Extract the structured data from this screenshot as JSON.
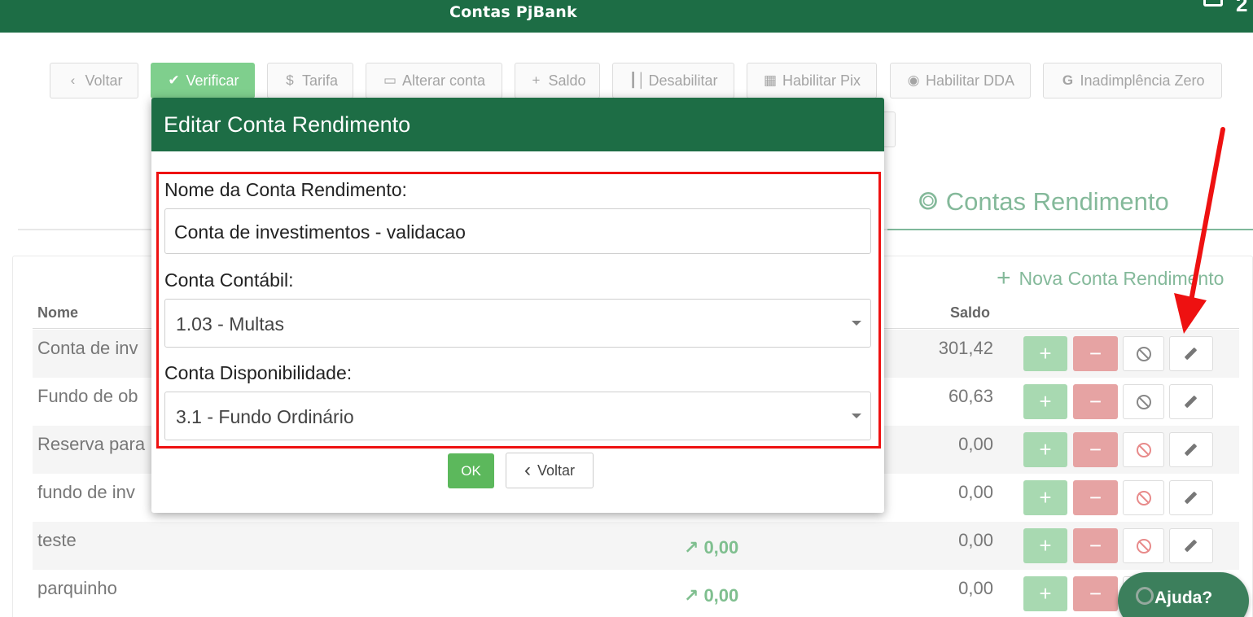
{
  "header": {
    "title": "Contas PjBank",
    "corner_text": "2"
  },
  "toolbar": {
    "voltar": "Voltar",
    "verificar": "Verificar",
    "tarifa": "Tarifa",
    "alterar_conta": "Alterar conta",
    "saldo": "Saldo",
    "desabilitar": "Desabilitar",
    "habilitar_pix": "Habilitar Pix",
    "habilitar_dda": "Habilitar DDA",
    "inadimplencia_zero": "Inadimplência Zero"
  },
  "section": {
    "title": "Contas Rendimento",
    "nova": "Nova Conta Rendimento"
  },
  "table": {
    "col_nome": "Nome",
    "col_saldo": "Saldo",
    "rows": [
      {
        "nome": "Conta de inv",
        "rendimento": "",
        "saldo": "301,42",
        "ban_color": "gray"
      },
      {
        "nome": "Fundo de ob",
        "rendimento": "",
        "saldo": "60,63",
        "ban_color": "gray"
      },
      {
        "nome": "Reserva para",
        "rendimento": "",
        "saldo": "0,00",
        "ban_color": "red"
      },
      {
        "nome": "fundo de inv",
        "rendimento": "",
        "saldo": "0,00",
        "ban_color": "red"
      },
      {
        "nome": "teste",
        "rendimento": "0,00",
        "saldo": "0,00",
        "ban_color": "red"
      },
      {
        "nome": "parquinho",
        "rendimento": "0,00",
        "saldo": "0,00",
        "ban_color": "red"
      }
    ]
  },
  "modal": {
    "title": "Editar Conta Rendimento",
    "nome_label": "Nome da Conta Rendimento:",
    "nome_value": "Conta de investimentos - validacao",
    "contabil_label": "Conta Contábil:",
    "contabil_value": "1.03 - Multas",
    "disponibilidade_label": "Conta Disponibilidade:",
    "disponibilidade_value": "3.1 - Fundo Ordinário",
    "ok": "OK",
    "voltar": "Voltar"
  },
  "help": {
    "label": "Ajuda?"
  },
  "colors": {
    "brand_green": "#1d6d45",
    "annotation_red": "#ee1111"
  }
}
